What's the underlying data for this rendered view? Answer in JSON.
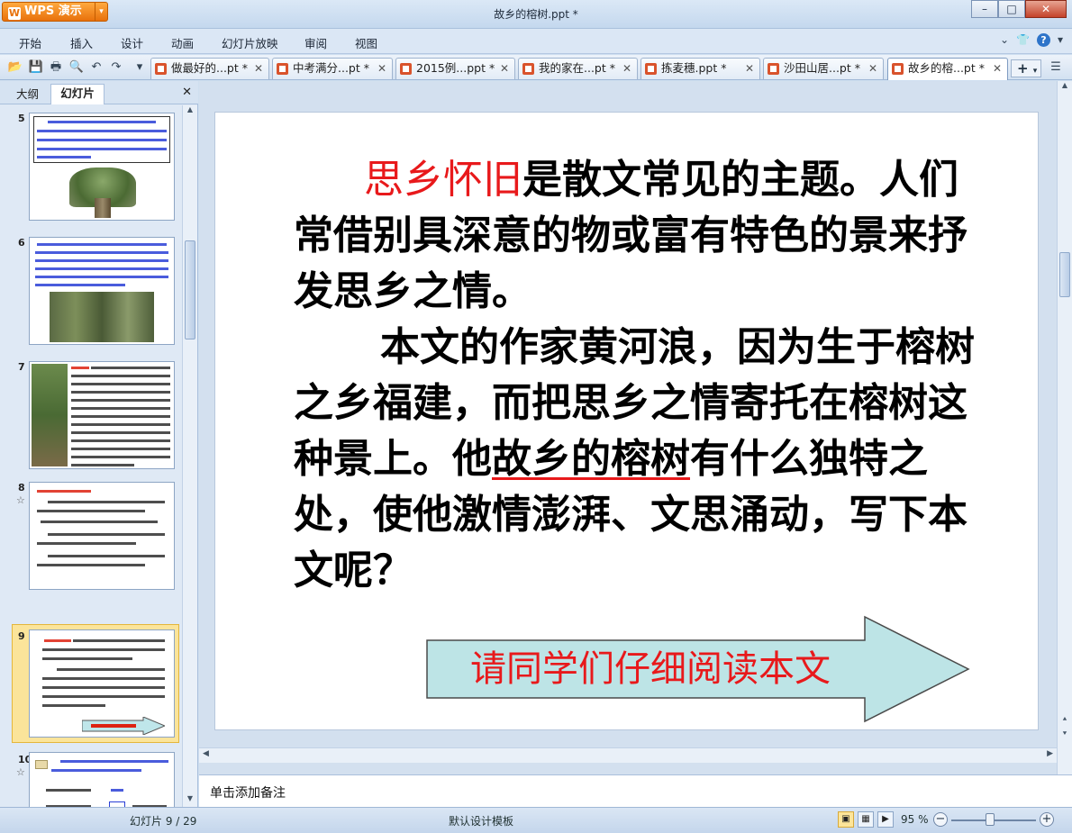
{
  "app": {
    "name": "WPS 演示",
    "window_title": "故乡的榕树.ppt *"
  },
  "menu": [
    "开始",
    "插入",
    "设计",
    "动画",
    "幻灯片放映",
    "审阅",
    "视图"
  ],
  "tabs": [
    {
      "label": "做最好的...pt *"
    },
    {
      "label": "中考满分...pt *"
    },
    {
      "label": "2015例...ppt *"
    },
    {
      "label": "我的家在...pt *"
    },
    {
      "label": "拣麦穗.ppt *"
    },
    {
      "label": "沙田山居...pt *"
    },
    {
      "label": "故乡的榕...pt *"
    }
  ],
  "panel": {
    "tab_outline": "大纲",
    "tab_slides": "幻灯片",
    "thumbnails": [
      {
        "num": "5"
      },
      {
        "num": "6"
      },
      {
        "num": "7"
      },
      {
        "num": "8"
      },
      {
        "num": "9"
      },
      {
        "num": "10"
      }
    ]
  },
  "slide": {
    "highlight": "思乡怀旧",
    "para1_rest": "是散文常见的主题。人们常借别具深意的物或富有特色的景来抒发思乡之情。",
    "para2_a": "本文的作家黄河浪，因为生于榕树之乡福建，而把思乡之情寄托在榕树这种景上。他",
    "para2_ul": "故乡的榕树",
    "para2_b": "有什么独特之处，使他激情澎湃、文思涌动，写下本文呢？",
    "arrow_label": "请同学们仔细阅读本文"
  },
  "notes_placeholder": "单击添加备注",
  "status": {
    "slide_counter": "幻灯片 9 / 29",
    "template": "默认设计模板",
    "zoom": "95 %"
  }
}
